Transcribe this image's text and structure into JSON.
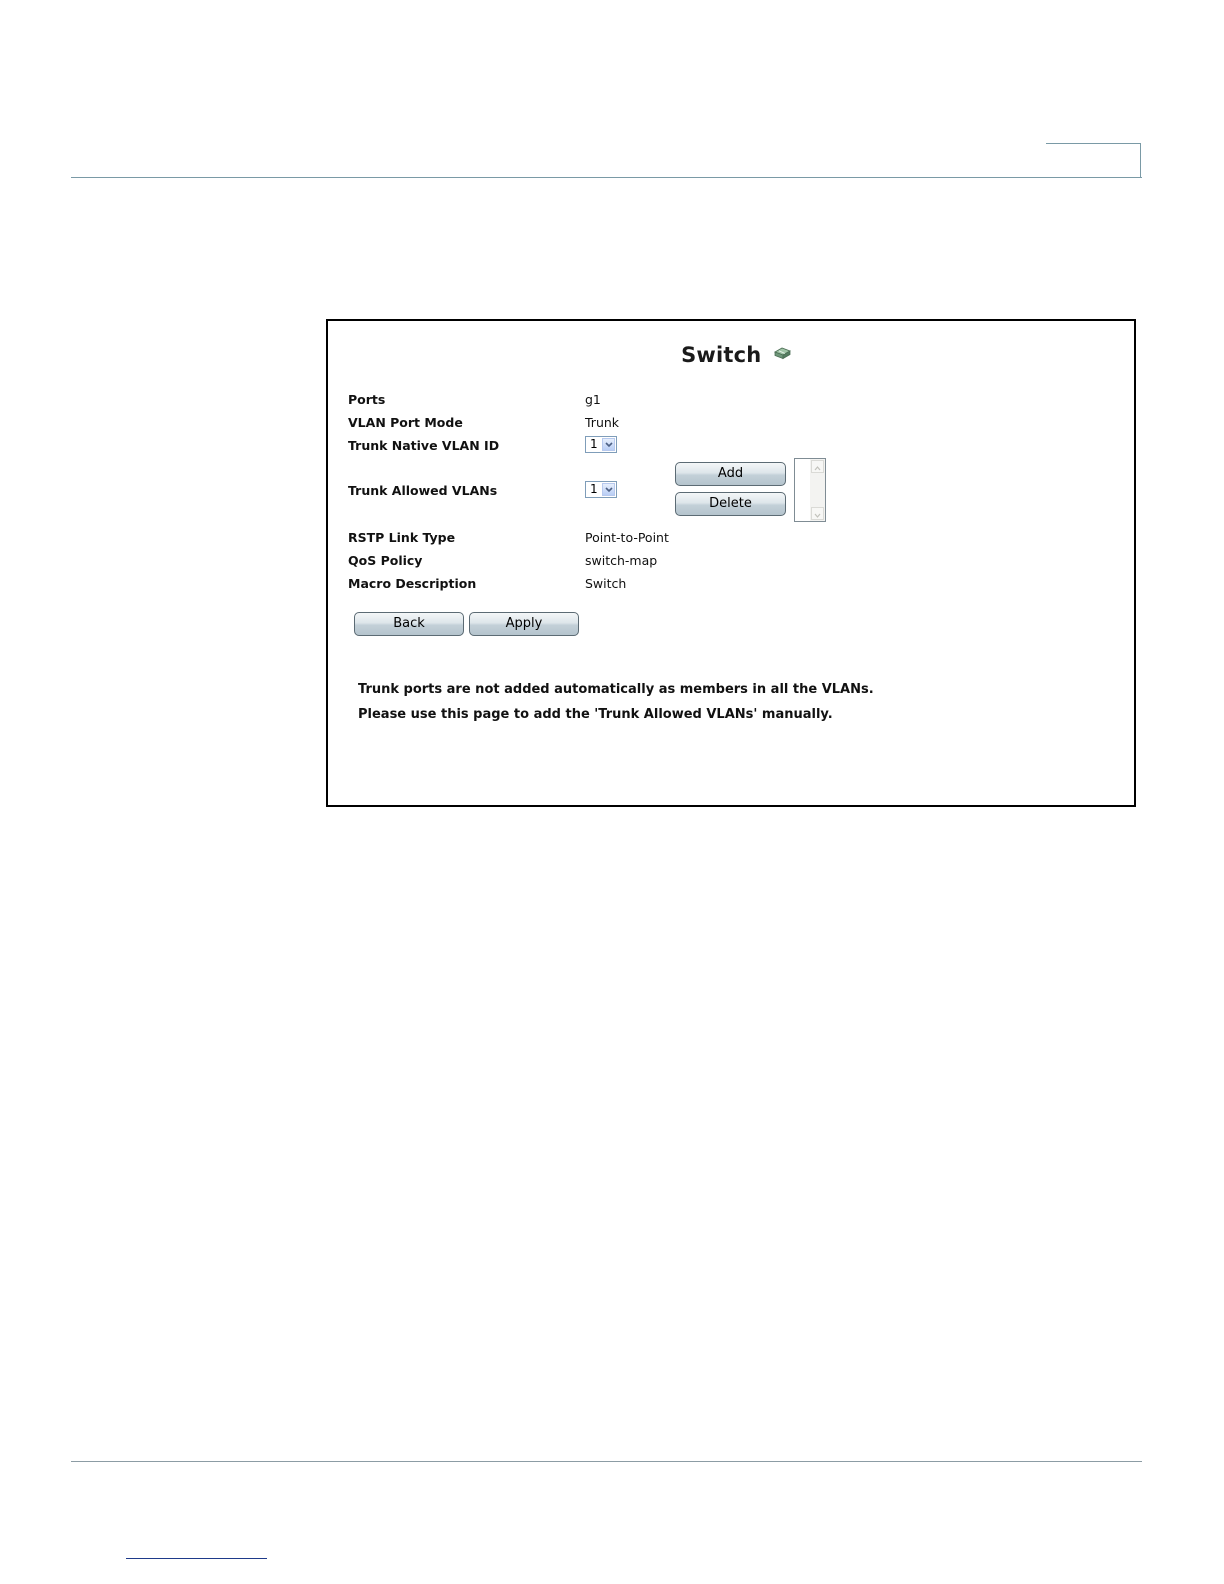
{
  "page": {
    "title": "Switch",
    "title_icon": "switch-device-icon"
  },
  "fields": {
    "ports": {
      "label": "Ports",
      "value": "g1"
    },
    "vlan_port_mode": {
      "label": "VLAN Port Mode",
      "value": "Trunk"
    },
    "trunk_native_vlan_id": {
      "label": "Trunk Native VLAN ID",
      "selected": "1"
    },
    "trunk_allowed_vlans": {
      "label": "Trunk Allowed VLANs",
      "selected": "1"
    },
    "rstp_link_type": {
      "label": "RSTP Link Type",
      "value": "Point-to-Point"
    },
    "qos_policy": {
      "label": "QoS Policy",
      "value": "switch-map"
    },
    "macro_description": {
      "label": "Macro Description",
      "value": "Switch"
    }
  },
  "buttons": {
    "add": "Add",
    "delete": "Delete",
    "back": "Back",
    "apply": "Apply"
  },
  "notes": {
    "line1": "Trunk ports are not added automatically as members in all the VLANs.",
    "line2": "Please use this page to add the 'Trunk Allowed VLANs' manually."
  },
  "colors": {
    "header_rule": "#7a9aa6",
    "select_border": "#7f9db9",
    "button_border": "#5c6b74"
  }
}
